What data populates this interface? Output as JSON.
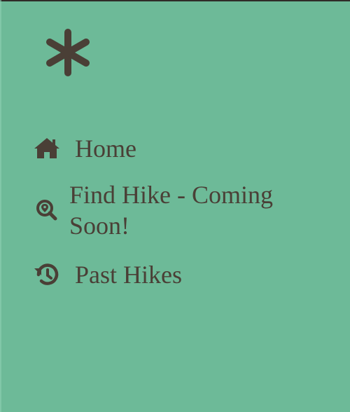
{
  "logo": {
    "icon": "asterisk-icon"
  },
  "nav": {
    "items": [
      {
        "label": "Home",
        "icon": "home-icon"
      },
      {
        "label": "Find Hike - Coming Soon!",
        "icon": "search-location-icon"
      },
      {
        "label": "Past Hikes",
        "icon": "history-icon"
      }
    ]
  },
  "colors": {
    "background": "#6dba98",
    "foreground": "#4a3f36",
    "top_border": "#2f2b28"
  }
}
